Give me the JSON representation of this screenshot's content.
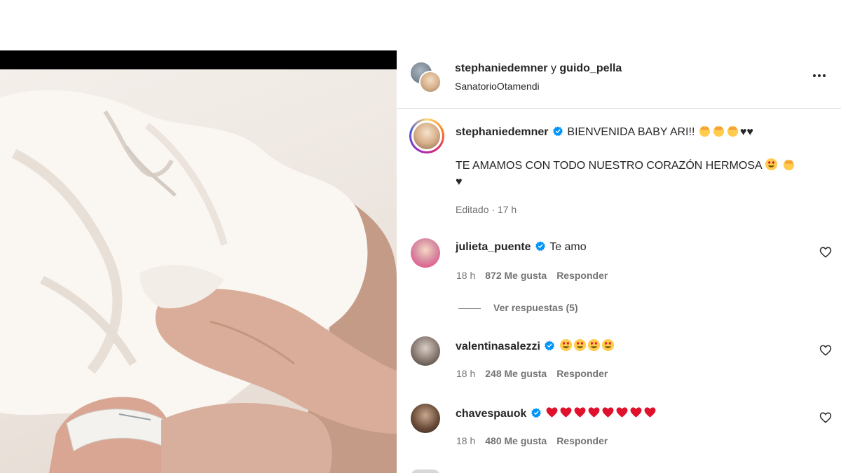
{
  "header": {
    "user1": "stephaniedemner",
    "connector": "y",
    "user2": "guido_pella",
    "location": "SanatorioOtamendi"
  },
  "caption": {
    "username": "stephaniedemner",
    "line1": "BIENVENIDA BABY ARI!!",
    "line2": "TE AMAMOS CON TODO NUESTRO CORAZÓN HERMOSA",
    "line3_heart": "♥",
    "hearts_suffix": "♥♥",
    "edited": "Editado",
    "dot": "·",
    "time": "17 h"
  },
  "comments": [
    {
      "username": "julieta_puente",
      "text": "Te amo",
      "time": "18 h",
      "likes": "872 Me gusta",
      "reply": "Responder"
    },
    {
      "username": "valentinasalezzi",
      "text": "",
      "time": "18 h",
      "likes": "248 Me gusta",
      "reply": "Responder"
    },
    {
      "username": "chavespauok",
      "text": "",
      "time": "18 h",
      "likes": "480 Me gusta",
      "reply": "Responder"
    }
  ],
  "view_replies": "Ver respuestas (5)",
  "icons": {
    "more": "more-horizontal-icon",
    "verified": "verified-badge-icon",
    "like": "heart-outline-icon"
  },
  "colors": {
    "verified": "#0095f6",
    "text": "#262626",
    "muted": "#737373",
    "heart_emoji": "#e0112d"
  }
}
